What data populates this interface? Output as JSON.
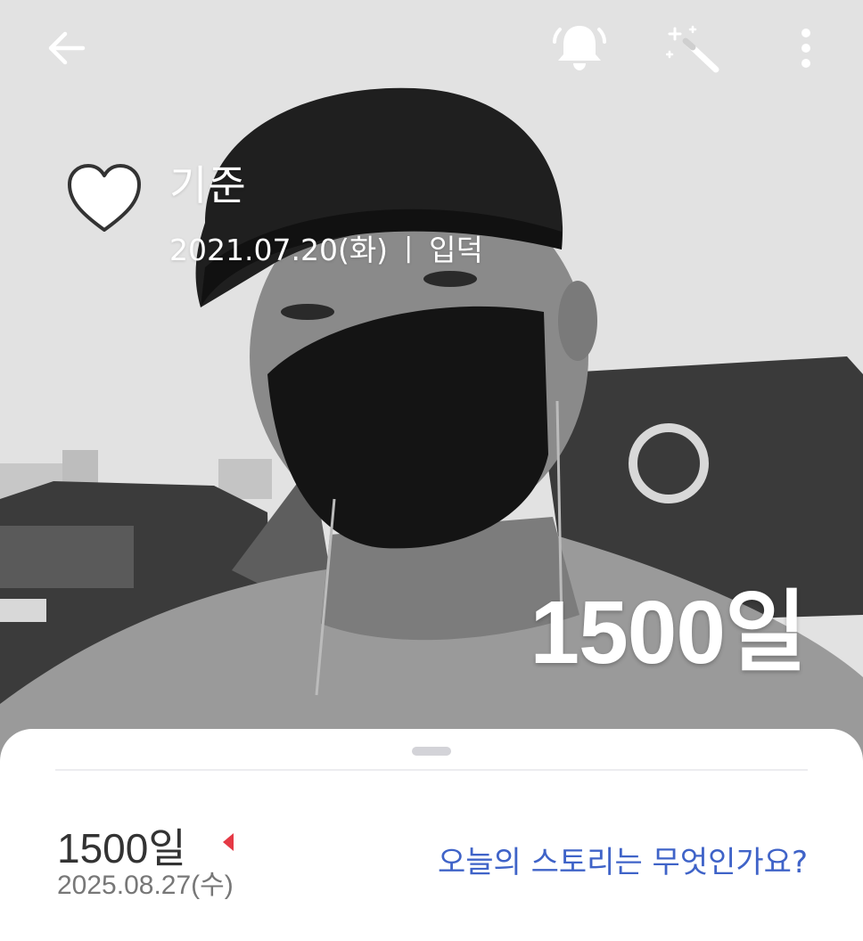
{
  "header": {
    "back_icon": "arrow-left-icon",
    "bell_icon": "bell-icon",
    "wand_icon": "magic-wand-icon",
    "more_icon": "more-vertical-icon"
  },
  "profile": {
    "heart_icon": "heart-outline-icon",
    "name": "기준",
    "enlist_date": "2021.07.20(화)",
    "separator": "|",
    "status": "입덕",
    "day_count_overlay": "1500일"
  },
  "sheet": {
    "day_count": "1500일",
    "date": "2025.08.27(수)",
    "story_prompt": "오늘의 스토리는 무엇인가요?",
    "marker_color": "#e53945",
    "prompt_color": "#3f63c8"
  }
}
